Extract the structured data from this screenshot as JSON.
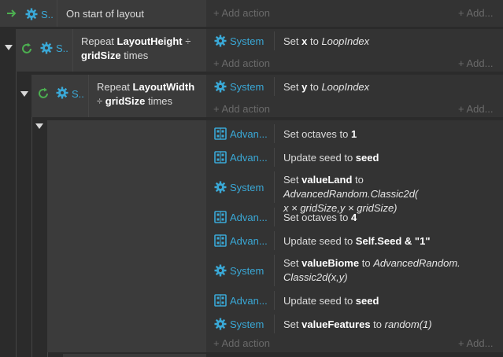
{
  "event1": {
    "sys_label": "S..",
    "condition": "On start of layout",
    "add_action": "+ Add action",
    "add_more": "+ Add..."
  },
  "event2": {
    "sys_label": "S..",
    "cond_prefix": "Repeat ",
    "cond_bold1": "LayoutHeight",
    "cond_mid": " ÷",
    "cond_bold2": "gridSize",
    "cond_suffix": " times",
    "action_obj": "System",
    "act_prefix": "Set ",
    "act_bold": "x",
    "act_mid": " to ",
    "act_italic": "LoopIndex",
    "add_action": "+ Add action",
    "add_more": "+ Add..."
  },
  "event3": {
    "sys_label": "S..",
    "cond_prefix": "Repeat ",
    "cond_bold1": "LayoutWidth",
    "cond_mid": "÷ ",
    "cond_bold2": "gridSize",
    "cond_suffix": " times",
    "action_obj": "System",
    "act_prefix": "Set ",
    "act_bold": "y",
    "act_mid": " to ",
    "act_italic": "LoopIndex",
    "add_action": "+ Add action",
    "add_more": "+ Add..."
  },
  "event4": {
    "actions": [
      {
        "obj": "Advan...",
        "icon": "advanced-random-icon",
        "p1": "Set octaves to ",
        "b1": "1"
      },
      {
        "obj": "Advan...",
        "icon": "advanced-random-icon",
        "p1": "Update seed to ",
        "b1": "seed"
      },
      {
        "obj": "System",
        "icon": "gear-icon",
        "p1": "Set ",
        "b1": "valueLand",
        "p2": " to ",
        "i1": "AdvancedRandom.Classic2d(",
        "i2": "x × gridSize,y × gridSize)"
      },
      {
        "obj": "Advan...",
        "icon": "advanced-random-icon",
        "p1": "Set octaves to ",
        "b1": "4"
      },
      {
        "obj": "Advan...",
        "icon": "advanced-random-icon",
        "p1": "Update seed to ",
        "b1": "Self.Seed & \"1\""
      },
      {
        "obj": "System",
        "icon": "gear-icon",
        "p1": "Set ",
        "b1": "valueBiome",
        "p2": " to ",
        "i1": "AdvancedRandom.",
        "i2": "Classic2d(x,y)"
      },
      {
        "obj": "Advan...",
        "icon": "advanced-random-icon",
        "p1": "Update seed to ",
        "b1": "seed"
      },
      {
        "obj": "System",
        "icon": "gear-icon",
        "p1": "Set ",
        "b1": "valueFeatures",
        "p2": " to ",
        "i1": "random(1)"
      }
    ],
    "add_action": "+ Add action",
    "add_more": "+ Add..."
  },
  "colors": {
    "accent": "#3aa8d6",
    "trigger_green": "#4caf50",
    "loop_green": "#4caf50",
    "background": "#2b2b2b"
  }
}
